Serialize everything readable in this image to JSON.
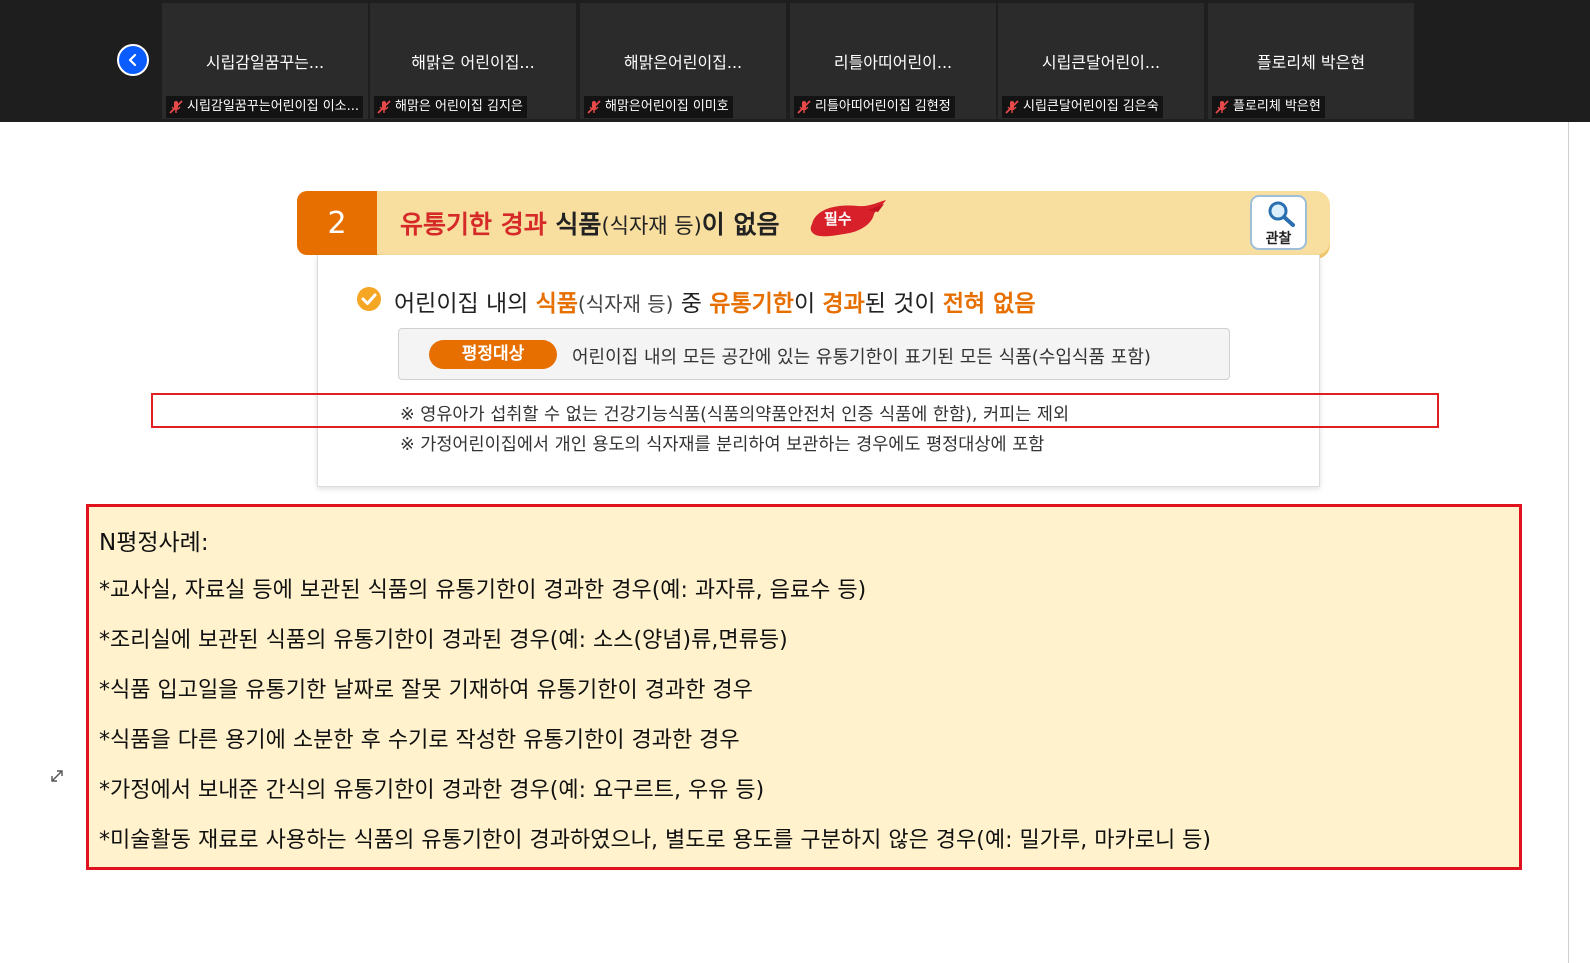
{
  "participants": [
    {
      "tile_name": "시립감일꿈꾸는...",
      "label": "시립감일꿈꾸는어린이집 이소..."
    },
    {
      "tile_name": "해맑은 어린이집...",
      "label": "해맑은 어린이집 김지은"
    },
    {
      "tile_name": "해맑은어린이집...",
      "label": "해맑은어린이집 이미호"
    },
    {
      "tile_name": "리틀아띠어린이...",
      "label": "리틀아띠어린이집 김현정"
    },
    {
      "tile_name": "시립큰달어린이...",
      "label": "시립큰달어린이집 김은숙"
    },
    {
      "tile_name": "플로리체 박은현",
      "label": "플로리체 박은현"
    }
  ],
  "slide": {
    "number": "2",
    "title_red": "유통기한 경과",
    "title_food": " 식품",
    "title_paren": "(식자재 등)",
    "title_end": "이 없음",
    "badge": "필수",
    "observe_label": "관찰",
    "criterion": {
      "p1": "어린이집 내의 ",
      "food": "식품",
      "paren": "(식자재 등)",
      "p2": " 중 ",
      "expiry": "유통기한",
      "p3": "이 ",
      "passed": "경과",
      "p4": "된 것이 ",
      "none": "전혀 없음"
    },
    "target_label": "평정대상",
    "target_text": "어린이집 내의 모든 공간에 있는 유통기한이 표기된 모든 식품(수입식품 포함)",
    "note1": "※  영유아가 섭취할 수 없는 건강기능식품(식품의약품안전처 인증 식품에 한함), 커피는 제외",
    "note2": "※  가정어린이집에서 개인 용도의 식자재를 분리하여 보관하는 경우에도 평정대상에 포함"
  },
  "cases": {
    "title": "N평정사례:",
    "items": [
      "*교사실, 자료실 등에 보관된 식품의 유통기한이 경과한 경우(예: 과자류, 음료수 등)",
      "*조리실에 보관된 식품의 유통기한이 경과된 경우(예: 소스(양념)류,면류등)",
      "*식품 입고일을 유통기한 날짜로 잘못 기재하여 유통기한이 경과한 경우",
      "*식품을 다른 용기에 소분한 후 수기로 작성한 유통기한이 경과한 경우",
      "*가정에서 보내준 간식의 유통기한이 경과한 경우(예: 요구르트, 우유 등)",
      "*미술활동 재료로 사용하는 식품의 유통기한이 경과하였으나, 별도로 용도를 구분하지 않은 경우(예: 밀가루, 마카로니 등)"
    ]
  },
  "icons": {
    "back": "chevron-left-icon",
    "mute": "mic-muted-icon",
    "observe": "magnifier-icon",
    "check": "check-circle-icon",
    "resize": "resize-icon"
  },
  "colors": {
    "orange": "#e66f00",
    "red": "#d62a28",
    "highlight": "#e0121e",
    "header_bg": "#f8dfa0",
    "cases_bg": "#fff2cc",
    "back_button": "#0b5cff"
  }
}
